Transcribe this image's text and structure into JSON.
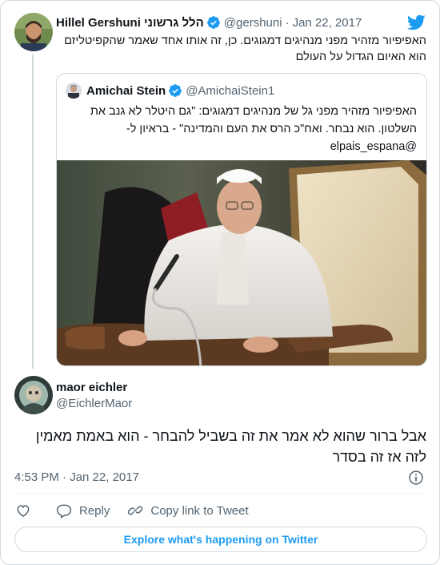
{
  "parent_tweet": {
    "author_name": "Hillel Gershuni הלל גרשוני",
    "handle": "@gershuni",
    "separator": "·",
    "date": "Jan 22, 2017",
    "text": "האפיפיור מזהיר מפני מנהיגים דמגוגים. כן, זה אותו אחד שאמר שהקפיטליזם הוא האיום הגדול על העולם"
  },
  "quoted_tweet": {
    "author_name": "Amichai Stein",
    "handle": "@AmichaiStein1",
    "text": "האפיפיור מזהיר מפני גל של מנהיגים דמגוגים: \"גם היטלר לא גנב את השלטון. הוא נבחר. ואח\"כ הרס את העם והמדינה\" - בראיון ל- @elpais_espana",
    "image_icon": "photo-pope-seated"
  },
  "reply_tweet": {
    "author_name": "maor eichler",
    "handle": "@EichlerMaor",
    "text": "אבל ברור שהוא לא אמר את זה בשביל להבחר - הוא באמת מאמין לזה אז זה בסדר",
    "time": "4:53 PM · Jan 22, 2017"
  },
  "actions": {
    "like_icon": "heart-icon",
    "reply_label": "Reply",
    "copy_label": "Copy link to Tweet"
  },
  "explore_label": "Explore what's happening on Twitter",
  "colors": {
    "accent": "#1d9bf0",
    "text": "#0f1419",
    "muted": "#536471",
    "border": "#cfd9de"
  }
}
